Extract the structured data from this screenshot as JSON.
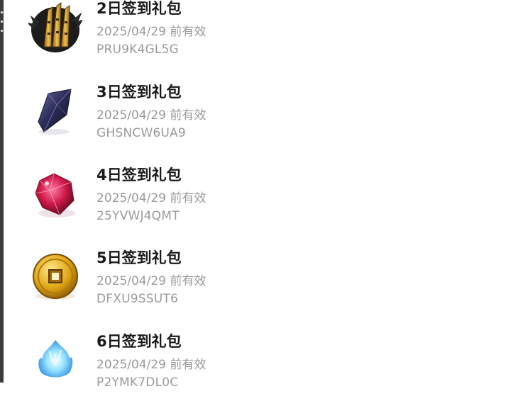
{
  "gifts": [
    {
      "title": "2日签到礼包",
      "expiry": "2025/04/29 前有效",
      "code": "PRU9K4GL5G",
      "icon": "golden-claw-icon"
    },
    {
      "title": "3日签到礼包",
      "expiry": "2025/04/29 前有效",
      "code": "GHSNCW6UA9",
      "icon": "dark-crystal-icon"
    },
    {
      "title": "4日签到礼包",
      "expiry": "2025/04/29 前有效",
      "code": "25YVWJ4QMT",
      "icon": "red-gem-icon"
    },
    {
      "title": "5日签到礼包",
      "expiry": "2025/04/29 前有效",
      "code": "DFXU9SSUT6",
      "icon": "gold-coin-icon"
    },
    {
      "title": "6日签到礼包",
      "expiry": "2025/04/29 前有效",
      "code": "P2YMK7DL0C",
      "icon": "blue-flame-icon"
    }
  ],
  "colors": {
    "title": "#1a1a1a",
    "secondary": "#9a9a9a",
    "background": "#ffffff",
    "edge": "#3b3b3b"
  }
}
